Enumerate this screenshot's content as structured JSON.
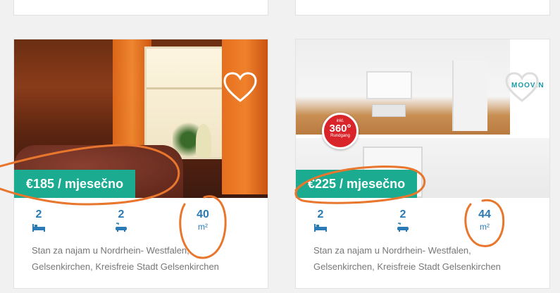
{
  "listings": [
    {
      "price": "€185 / mjesečno",
      "bedrooms": "2",
      "bathrooms": "2",
      "area": "40",
      "area_unit": "m²",
      "address_line1": "Stan za najam u Nordrhein- Westfalen,",
      "address_line2": "Gelsenkirchen, Kreisfreie Stadt Gelsenkirchen",
      "favorited": false
    },
    {
      "price": "€225 / mjesečno",
      "bedrooms": "2",
      "bathrooms": "2",
      "area": "44",
      "area_unit": "m²",
      "address_line1": "Stan za najam u Nordrhein- Westfalen,",
      "address_line2": "Gelsenkirchen, Kreisfreie Stadt Gelsenkirchen",
      "favorited": false,
      "photo_logo": "MOOVIN",
      "badge": {
        "line1": "inkl.",
        "line2": "360°",
        "line3": "Rundgang"
      }
    }
  ],
  "colors": {
    "accent": "#1aab90",
    "feature_blue": "#2a7ab5",
    "annotation": "#e8762c"
  },
  "icons": {
    "bed": "bed-icon",
    "bath": "bathtub-icon",
    "heart": "heart-icon"
  }
}
